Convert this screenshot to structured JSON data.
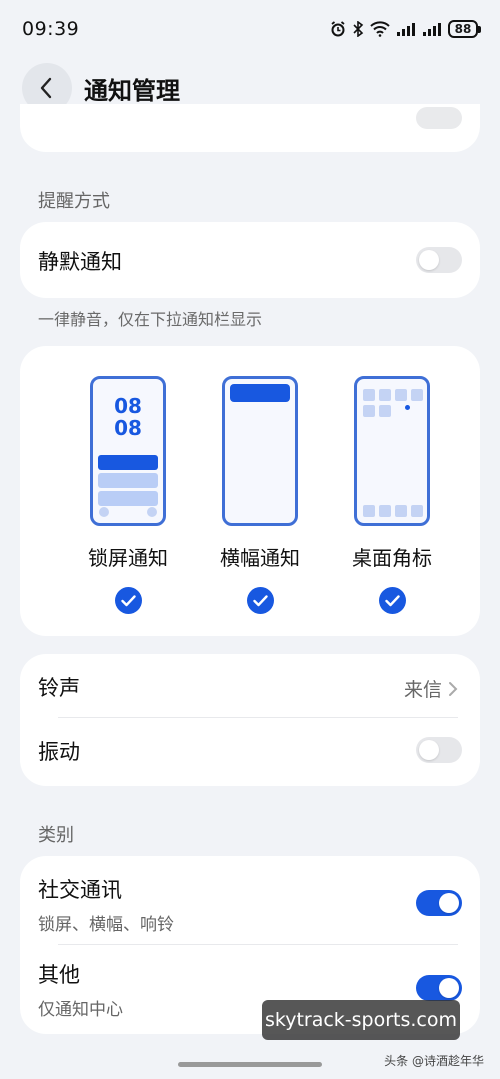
{
  "status_bar": {
    "time": "09:39",
    "battery": "88",
    "icons": [
      "alarm-icon",
      "bluetooth-icon",
      "wifi-icon",
      "signal-icon",
      "signal-icon",
      "battery-icon"
    ]
  },
  "header": {
    "title": "通知管理",
    "back_icon": "chevron-left-icon"
  },
  "sections": {
    "reminder_label": "提醒方式",
    "category_label": "类别"
  },
  "silent": {
    "label": "静默通知",
    "enabled": false,
    "helper": "一律静音，仅在下拉通知栏显示"
  },
  "styles": [
    {
      "label": "锁屏通知",
      "selected": true,
      "clock": [
        "08",
        "08"
      ]
    },
    {
      "label": "横幅通知",
      "selected": true
    },
    {
      "label": "桌面角标",
      "selected": true
    }
  ],
  "ringtone": {
    "label": "铃声",
    "value": "来信"
  },
  "vibration": {
    "label": "振动",
    "enabled": false
  },
  "categories": [
    {
      "label": "社交通讯",
      "sub": "锁屏、横幅、响铃",
      "enabled": true
    },
    {
      "label": "其他",
      "sub": "仅通知中心",
      "enabled": true
    }
  ],
  "overlay": {
    "watermark": "skytrack-sports.com",
    "source": "头条 @诗酒趁年华"
  },
  "colors": {
    "accent": "#1858e0",
    "background": "#f1f3f7",
    "card": "#ffffff"
  }
}
